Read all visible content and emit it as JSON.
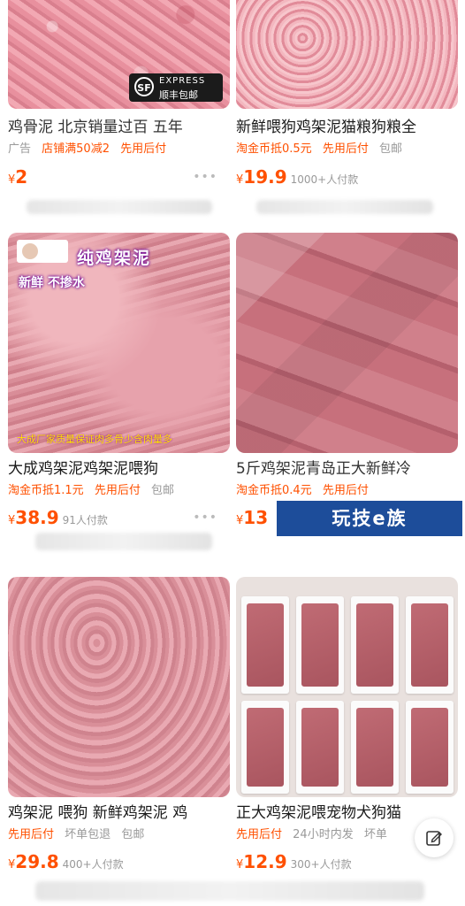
{
  "products": [
    {
      "title": "鸡骨泥 北京销量过百 五年",
      "tags": [
        "广告",
        "店铺满50减2",
        "先用后付"
      ],
      "price_symbol": "¥",
      "price_value": "2",
      "sold": "",
      "badge": {
        "top": "EXPRESS",
        "bottom": "顺丰包邮",
        "icon": "SF"
      }
    },
    {
      "title": "新鲜喂狗鸡架泥猫粮狗粮全",
      "tags": [
        "淘金币抵0.5元",
        "先用后付",
        "包邮"
      ],
      "price_symbol": "¥",
      "price_value": "19.9",
      "sold": "1000+人付款"
    },
    {
      "title": "大成鸡架泥鸡架泥喂狗",
      "tags": [
        "淘金币抵1.1元",
        "先用后付",
        "包邮"
      ],
      "price_symbol": "¥",
      "price_value": "38.9",
      "sold": "91人付款",
      "overlay": {
        "title": "纯鸡架泥",
        "sub": "新鲜 不掺水",
        "bottom": "大成厂家质量保证肉多骨少含肉量多"
      }
    },
    {
      "title": "5斤鸡架泥青岛正大新鲜冷",
      "tags": [
        "淘金币抵0.4元",
        "先用后付"
      ],
      "price_symbol": "¥",
      "price_value": "13",
      "sold": ""
    },
    {
      "title": "鸡架泥 喂狗 新鲜鸡架泥 鸡",
      "tags": [
        "先用后付",
        "坏单包退",
        "包邮"
      ],
      "price_symbol": "¥",
      "price_value": "29.8",
      "sold": "400+人付款"
    },
    {
      "title": "正大鸡架泥喂宠物犬狗猫",
      "tags": [
        "先用后付",
        "24小时内发",
        "坏单"
      ],
      "price_symbol": "¥",
      "price_value": "12.9",
      "sold": "300+人付款"
    }
  ],
  "more_icon": "•••",
  "watermark": "玩技e族",
  "float_button_icon": "edit-icon",
  "colors": {
    "accent": "#ff5000",
    "muted": "#999999",
    "watermark_bg": "#1d4d9a"
  }
}
